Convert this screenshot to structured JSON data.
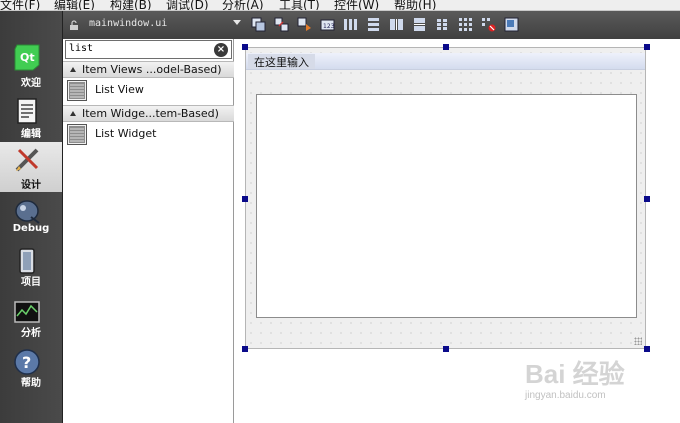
{
  "menubar": {
    "items": [
      "文件(F)",
      "编辑(E)",
      "构建(B)",
      "调试(D)",
      "分析(A)",
      "工具(T)",
      "控件(W)",
      "帮助(H)"
    ]
  },
  "modes": [
    {
      "label": "欢迎",
      "icon": "qt-logo-icon"
    },
    {
      "label": "编辑",
      "icon": "edit-document-icon"
    },
    {
      "label": "设计",
      "icon": "design-pen-icon"
    },
    {
      "label": "Debug",
      "icon": "debug-bug-icon"
    },
    {
      "label": "项目",
      "icon": "project-icon"
    },
    {
      "label": "分析",
      "icon": "analyze-icon"
    },
    {
      "label": "帮助",
      "icon": "help-icon"
    }
  ],
  "active_mode": "设计",
  "editor": {
    "filename": "mainwindow.ui"
  },
  "toolbar_icons": [
    "edit-widgets-icon",
    "edit-signals-slots-icon",
    "edit-buddies-icon",
    "edit-tab-order-icon",
    "layout-horizontal-icon",
    "layout-vertical-icon",
    "layout-h-splitter-icon",
    "layout-v-splitter-icon",
    "layout-form-icon",
    "layout-grid-icon",
    "break-layout-icon",
    "adjust-size-icon"
  ],
  "widgetbox": {
    "filter_value": "list",
    "categories": [
      {
        "title": "Item Views ...odel-Based)",
        "items": [
          "List View"
        ]
      },
      {
        "title": "Item Widge...tem-Based)",
        "items": [
          "List Widget"
        ]
      }
    ]
  },
  "form": {
    "menubar_placeholder": "在这里输入"
  },
  "watermark": {
    "brand": "Bai 经验",
    "url": "jingyan.baidu.com"
  },
  "colors": {
    "modebar_bg": "#404040",
    "selection_handle": "#0a0a8a",
    "menubar_placeholder_bg": "#d6dbe8"
  }
}
